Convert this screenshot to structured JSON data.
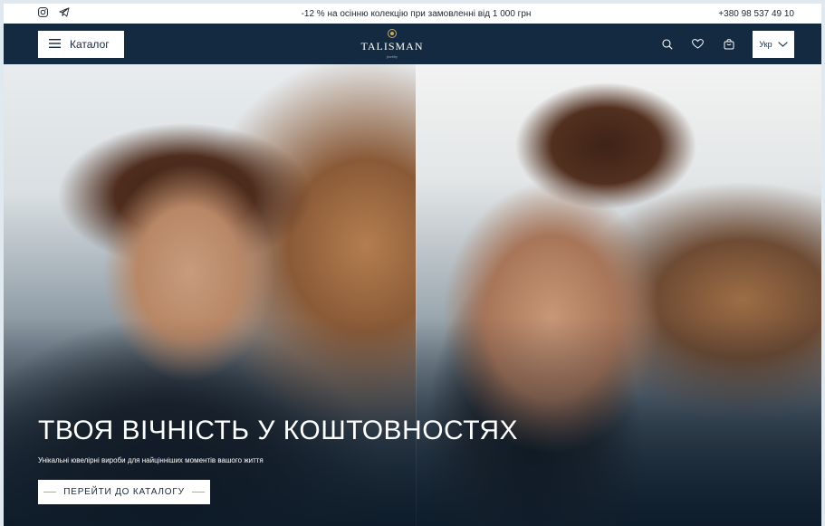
{
  "topbar": {
    "icons": [
      "instagram-icon",
      "telegram-icon"
    ],
    "promo": "-12 % на осінню колекцію при замовленні від 1 000 грн",
    "phone": "+380 98 537 49 10"
  },
  "header": {
    "catalog_label": "Каталог",
    "logo_name": "TALISMAN",
    "logo_sub": "jewelry",
    "icons": [
      "search-icon",
      "heart-icon",
      "bag-icon"
    ],
    "language": "Укр"
  },
  "hero": {
    "title": "ТВОЯ ВІЧНІСТЬ У КОШТОВНОСТЯХ",
    "subtitle": "Унікальні ювелірні вироби для найцінніших моментів вашого життя",
    "cta_label": "ПЕРЕЙТИ ДО КАТАЛОГУ"
  },
  "colors": {
    "header_bg": "#132a40",
    "accent": "#c9a86a",
    "page_bg": "#dfe9ef"
  }
}
